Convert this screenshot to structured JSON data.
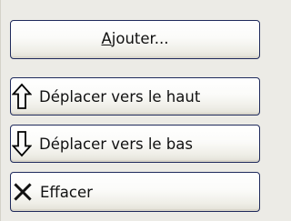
{
  "buttons": {
    "add": {
      "label_underlined": "A",
      "label_rest": "jouter..."
    },
    "move_up": {
      "label": "Déplacer vers le haut",
      "icon": "arrow-up-icon"
    },
    "move_down": {
      "label": "Déplacer vers le bas",
      "icon": "arrow-down-icon"
    },
    "remove": {
      "label": "Effacer",
      "icon": "delete-x-icon"
    }
  },
  "colors": {
    "background": "#ecebe6",
    "button_border": "#1f2a5c"
  }
}
